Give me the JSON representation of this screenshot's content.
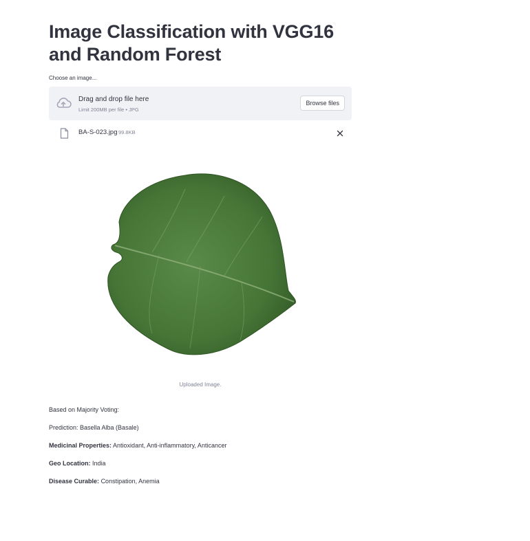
{
  "page": {
    "title": "Image Classification with VGG16 and Random Forest"
  },
  "uploader": {
    "label": "Choose an image...",
    "drag_text": "Drag and drop file here",
    "limit_text": "Limit 200MB per file • JPG",
    "browse_label": "Browse files",
    "cloud_icon": "cloud-upload-icon"
  },
  "file": {
    "name": "BA-S-023.jpg",
    "size": "99.8KB",
    "file_icon": "file-icon",
    "close_icon": "close-icon"
  },
  "image": {
    "caption": "Uploaded Image."
  },
  "results": {
    "voting": "Based on Majority Voting:",
    "prediction": "Prediction: Basella Alba (Basale)",
    "medicinal_label": "Medicinal Properties:",
    "medicinal_value": "Antioxidant, Anti-inflammatory, Anticancer",
    "geo_label": "Geo Location:",
    "geo_value": "India",
    "disease_label": "Disease Curable:",
    "disease_value": "Constipation, Anemia"
  },
  "colors": {
    "text": "#31333f",
    "muted": "#808495",
    "dropzone_bg": "#f0f2f6",
    "leaf": "#4a7a3e"
  }
}
